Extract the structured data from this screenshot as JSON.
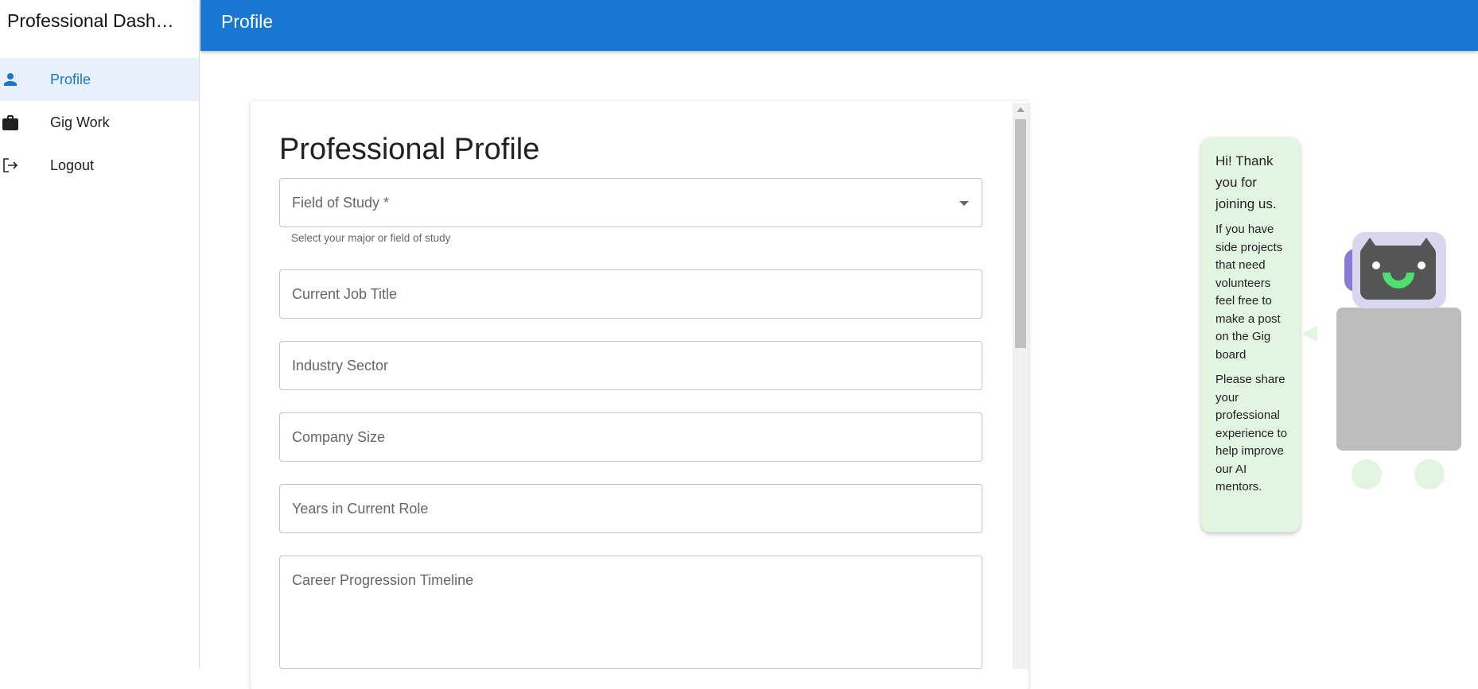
{
  "app": {
    "title": "Professional Dash…"
  },
  "sidebar": {
    "items": [
      {
        "label": "Profile",
        "icon": "person-icon",
        "active": true
      },
      {
        "label": "Gig Work",
        "icon": "briefcase-icon",
        "active": false
      },
      {
        "label": "Logout",
        "icon": "logout-icon",
        "active": false
      }
    ]
  },
  "appbar": {
    "title": "Profile"
  },
  "form": {
    "title": "Professional Profile",
    "field_of_study": {
      "label": "Field of Study *",
      "helper": "Select your major or field of study",
      "value": ""
    },
    "job_title": {
      "placeholder": "Current Job Title",
      "value": ""
    },
    "industry": {
      "placeholder": "Industry Sector",
      "value": ""
    },
    "company_size": {
      "placeholder": "Company Size",
      "value": ""
    },
    "years_in_role": {
      "placeholder": "Years in Current Role",
      "value": ""
    },
    "career_timeline": {
      "placeholder": "Career Progression Timeline",
      "value": ""
    }
  },
  "chat": {
    "greeting": "Hi! Thank you for joining us.",
    "message1": "If you have side projects that need volunteers feel free to make a post on the Gig board",
    "message2": "Please share your professional experience to help improve our AI mentors."
  },
  "colors": {
    "primary": "#1976d2",
    "active_bg": "#e8f1fb",
    "bubble_bg": "#e1f5e1"
  }
}
